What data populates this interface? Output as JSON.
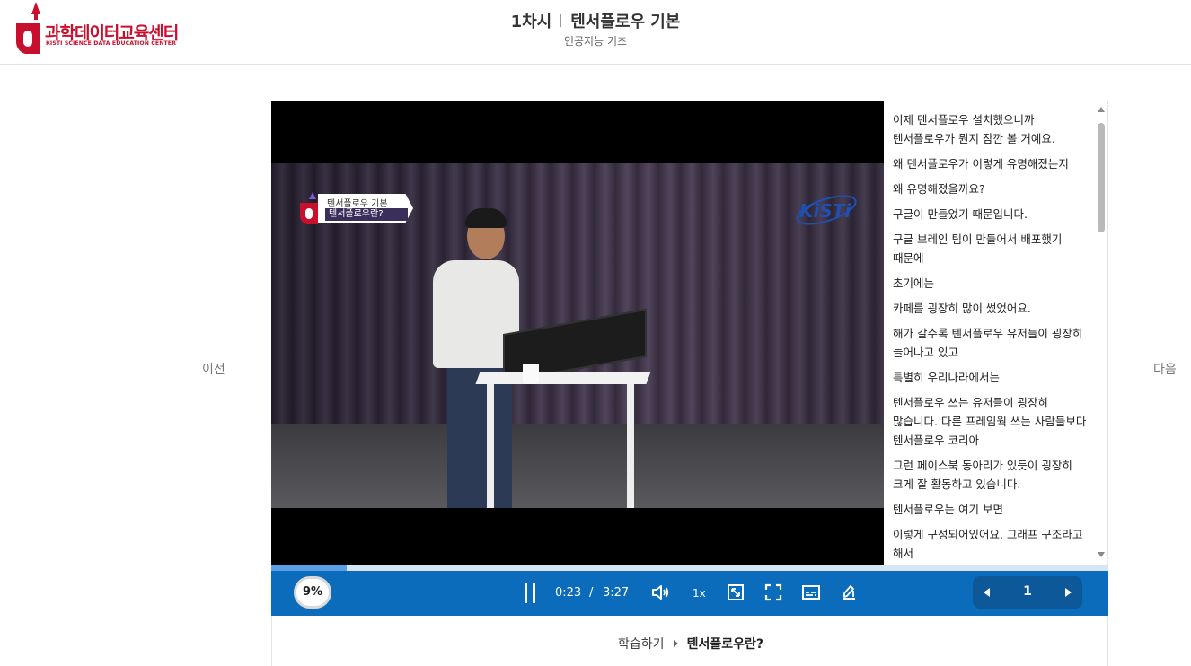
{
  "brand": {
    "name": "과학데이터교육센터",
    "subtitle": "KISTI SCIENCE DATA EDUCATION CENTER",
    "color": "#c8102e"
  },
  "header": {
    "session": "1차시",
    "title": "텐서플로우 기본",
    "course": "인공지능 기초"
  },
  "nav": {
    "prev": "이전",
    "next": "다음"
  },
  "video": {
    "badge_top": "텐서플로우 기본",
    "badge_bottom": "텐서플로우란?",
    "watermark": "KiSTi",
    "progress_percent": 9
  },
  "transcript": [
    "이제 텐서플로우 설치했으니까 텐서플로우가 뭔지 잠깐 볼 거예요.",
    "왜 텐서플로우가 이렇게 유명해졌는지",
    "왜 유명해졌을까요?",
    "구글이 만들었기 때문입니다.",
    "구글 브레인 팀이 만들어서 배포했기 때문에",
    "초기에는",
    "카페를 굉장히 많이 썼었어요.",
    "해가 갈수록 텐서플로우 유저들이 굉장히 늘어나고 있고",
    "특별히 우리나라에서는",
    "텐서플로우 쓰는 유저들이 굉장히 많습니다. 다른 프레임웍 쓰는 사람들보다 텐서플로우 코리아",
    "그런 페이스북 동아리가 있듯이 굉장히 크게 잘 활동하고 있습니다.",
    "텐서플로우는 여기 보면",
    "이렇게 구성되어있어요. 그래프 구조라고 해서"
  ],
  "controls": {
    "progress_label": "9%",
    "time_current": "0:23",
    "time_separator": "/",
    "time_total": "3:27",
    "speed": "1x",
    "page": "1",
    "icons": [
      "pause-icon",
      "volume-icon",
      "resize-icon",
      "fullscreen-icon",
      "subtitles-icon",
      "memo-icon"
    ],
    "accent": "#0a6cba"
  },
  "lesson": {
    "crumb": "학습하기",
    "current": "텐서플로우란?"
  }
}
